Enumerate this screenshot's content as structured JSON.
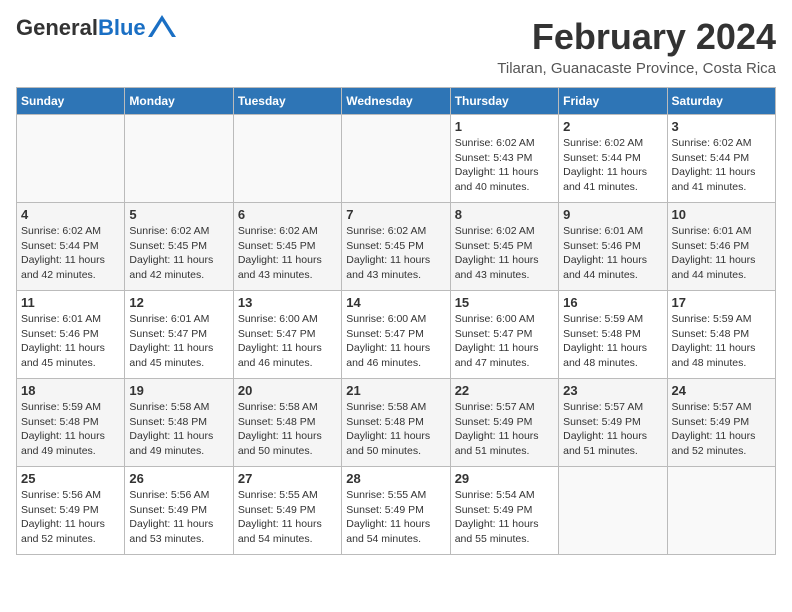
{
  "header": {
    "logo_general": "General",
    "logo_blue": "Blue",
    "title": "February 2024",
    "subtitle": "Tilaran, Guanacaste Province, Costa Rica"
  },
  "days_of_week": [
    "Sunday",
    "Monday",
    "Tuesday",
    "Wednesday",
    "Thursday",
    "Friday",
    "Saturday"
  ],
  "weeks": [
    [
      {
        "day": "",
        "info": ""
      },
      {
        "day": "",
        "info": ""
      },
      {
        "day": "",
        "info": ""
      },
      {
        "day": "",
        "info": ""
      },
      {
        "day": "1",
        "info": "Sunrise: 6:02 AM\nSunset: 5:43 PM\nDaylight: 11 hours\nand 40 minutes."
      },
      {
        "day": "2",
        "info": "Sunrise: 6:02 AM\nSunset: 5:44 PM\nDaylight: 11 hours\nand 41 minutes."
      },
      {
        "day": "3",
        "info": "Sunrise: 6:02 AM\nSunset: 5:44 PM\nDaylight: 11 hours\nand 41 minutes."
      }
    ],
    [
      {
        "day": "4",
        "info": "Sunrise: 6:02 AM\nSunset: 5:44 PM\nDaylight: 11 hours\nand 42 minutes."
      },
      {
        "day": "5",
        "info": "Sunrise: 6:02 AM\nSunset: 5:45 PM\nDaylight: 11 hours\nand 42 minutes."
      },
      {
        "day": "6",
        "info": "Sunrise: 6:02 AM\nSunset: 5:45 PM\nDaylight: 11 hours\nand 43 minutes."
      },
      {
        "day": "7",
        "info": "Sunrise: 6:02 AM\nSunset: 5:45 PM\nDaylight: 11 hours\nand 43 minutes."
      },
      {
        "day": "8",
        "info": "Sunrise: 6:02 AM\nSunset: 5:45 PM\nDaylight: 11 hours\nand 43 minutes."
      },
      {
        "day": "9",
        "info": "Sunrise: 6:01 AM\nSunset: 5:46 PM\nDaylight: 11 hours\nand 44 minutes."
      },
      {
        "day": "10",
        "info": "Sunrise: 6:01 AM\nSunset: 5:46 PM\nDaylight: 11 hours\nand 44 minutes."
      }
    ],
    [
      {
        "day": "11",
        "info": "Sunrise: 6:01 AM\nSunset: 5:46 PM\nDaylight: 11 hours\nand 45 minutes."
      },
      {
        "day": "12",
        "info": "Sunrise: 6:01 AM\nSunset: 5:47 PM\nDaylight: 11 hours\nand 45 minutes."
      },
      {
        "day": "13",
        "info": "Sunrise: 6:00 AM\nSunset: 5:47 PM\nDaylight: 11 hours\nand 46 minutes."
      },
      {
        "day": "14",
        "info": "Sunrise: 6:00 AM\nSunset: 5:47 PM\nDaylight: 11 hours\nand 46 minutes."
      },
      {
        "day": "15",
        "info": "Sunrise: 6:00 AM\nSunset: 5:47 PM\nDaylight: 11 hours\nand 47 minutes."
      },
      {
        "day": "16",
        "info": "Sunrise: 5:59 AM\nSunset: 5:48 PM\nDaylight: 11 hours\nand 48 minutes."
      },
      {
        "day": "17",
        "info": "Sunrise: 5:59 AM\nSunset: 5:48 PM\nDaylight: 11 hours\nand 48 minutes."
      }
    ],
    [
      {
        "day": "18",
        "info": "Sunrise: 5:59 AM\nSunset: 5:48 PM\nDaylight: 11 hours\nand 49 minutes."
      },
      {
        "day": "19",
        "info": "Sunrise: 5:58 AM\nSunset: 5:48 PM\nDaylight: 11 hours\nand 49 minutes."
      },
      {
        "day": "20",
        "info": "Sunrise: 5:58 AM\nSunset: 5:48 PM\nDaylight: 11 hours\nand 50 minutes."
      },
      {
        "day": "21",
        "info": "Sunrise: 5:58 AM\nSunset: 5:48 PM\nDaylight: 11 hours\nand 50 minutes."
      },
      {
        "day": "22",
        "info": "Sunrise: 5:57 AM\nSunset: 5:49 PM\nDaylight: 11 hours\nand 51 minutes."
      },
      {
        "day": "23",
        "info": "Sunrise: 5:57 AM\nSunset: 5:49 PM\nDaylight: 11 hours\nand 51 minutes."
      },
      {
        "day": "24",
        "info": "Sunrise: 5:57 AM\nSunset: 5:49 PM\nDaylight: 11 hours\nand 52 minutes."
      }
    ],
    [
      {
        "day": "25",
        "info": "Sunrise: 5:56 AM\nSunset: 5:49 PM\nDaylight: 11 hours\nand 52 minutes."
      },
      {
        "day": "26",
        "info": "Sunrise: 5:56 AM\nSunset: 5:49 PM\nDaylight: 11 hours\nand 53 minutes."
      },
      {
        "day": "27",
        "info": "Sunrise: 5:55 AM\nSunset: 5:49 PM\nDaylight: 11 hours\nand 54 minutes."
      },
      {
        "day": "28",
        "info": "Sunrise: 5:55 AM\nSunset: 5:49 PM\nDaylight: 11 hours\nand 54 minutes."
      },
      {
        "day": "29",
        "info": "Sunrise: 5:54 AM\nSunset: 5:49 PM\nDaylight: 11 hours\nand 55 minutes."
      },
      {
        "day": "",
        "info": ""
      },
      {
        "day": "",
        "info": ""
      }
    ]
  ]
}
